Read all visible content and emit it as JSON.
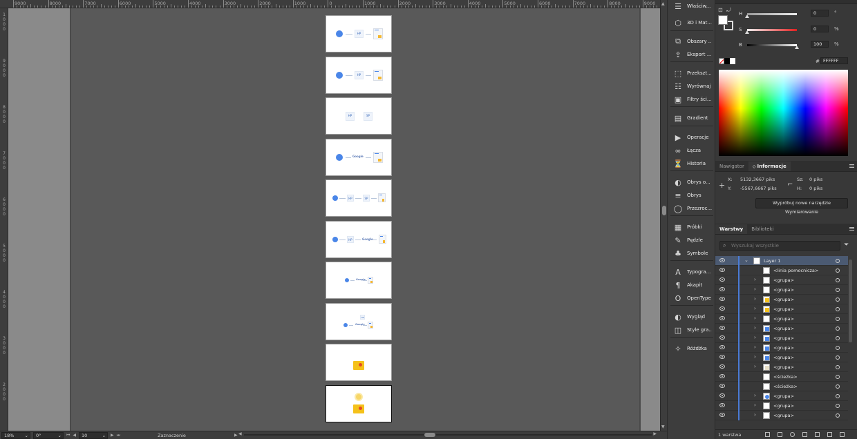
{
  "ruler": {
    "top_labels": [
      "9000",
      "8000",
      "7000",
      "6000",
      "5000",
      "4000",
      "3000",
      "2000",
      "1000",
      "0",
      "1000",
      "2000",
      "3000",
      "4000",
      "5000",
      "6000",
      "7000",
      "8000",
      "9000"
    ],
    "left_labels": [
      "1",
      "0",
      "0",
      "0",
      "9",
      "0",
      "0",
      "0",
      "8",
      "0",
      "0",
      "0",
      "7",
      "0",
      "0",
      "0",
      "6",
      "0",
      "0",
      "0",
      "5",
      "0",
      "0",
      "0",
      "4",
      "0",
      "0",
      "0",
      "3",
      "0",
      "0",
      "0",
      "2",
      "0",
      "0",
      "0",
      "1",
      "0",
      "0",
      "0"
    ]
  },
  "artboards": [
    {
      "kind": "flow-hp-doc",
      "labels": [
        "HP"
      ]
    },
    {
      "kind": "flow-hp-doc",
      "labels": [
        "HP"
      ]
    },
    {
      "kind": "two-chips",
      "labels": [
        "HP",
        "SP"
      ]
    },
    {
      "kind": "flow-google-doc",
      "labels": [
        "Google"
      ]
    },
    {
      "kind": "flow-hp-sp-doc",
      "labels": [
        "HP",
        "SP"
      ]
    },
    {
      "kind": "flow-hp-google-doc",
      "labels": [
        "HP",
        "Google"
      ]
    },
    {
      "kind": "small-google",
      "labels": [
        "Google"
      ]
    },
    {
      "kind": "small-hp-google",
      "labels": [
        "HP",
        "Google"
      ]
    },
    {
      "kind": "box",
      "labels": []
    },
    {
      "kind": "box-sun",
      "labels": []
    }
  ],
  "status": {
    "zoom": "18%",
    "rotation": "0°",
    "artboard_number": "10",
    "tool": "Zaznaczenie"
  },
  "dock": {
    "items": [
      {
        "label": "Właściw...",
        "icon": "properties-icon"
      },
      {
        "label": "3D i Mat...",
        "icon": "cube-icon"
      },
      {
        "label": "Obszary ...",
        "icon": "artboards-icon"
      },
      {
        "label": "Eksport ...",
        "icon": "export-icon"
      },
      {
        "label": "Przekszt...",
        "icon": "transform-icon"
      },
      {
        "label": "Wyrównaj",
        "icon": "align-icon"
      },
      {
        "label": "Filtry ści...",
        "icon": "pathfinder-icon"
      },
      {
        "label": "Gradient",
        "icon": "gradient-icon"
      },
      {
        "label": "Operacje",
        "icon": "actions-icon"
      },
      {
        "label": "Łącza",
        "icon": "links-icon"
      },
      {
        "label": "Historia",
        "icon": "history-icon"
      },
      {
        "label": "Obrys o...",
        "icon": "appearance-icon"
      },
      {
        "label": "Obrys",
        "icon": "stroke-icon"
      },
      {
        "label": "Przezroc...",
        "icon": "transparency-icon"
      },
      {
        "label": "Próbki",
        "icon": "swatches-icon"
      },
      {
        "label": "Pędzle",
        "icon": "brushes-icon"
      },
      {
        "label": "Symbole",
        "icon": "symbols-icon"
      },
      {
        "label": "Typogra...",
        "icon": "character-icon"
      },
      {
        "label": "Akapit",
        "icon": "paragraph-icon"
      },
      {
        "label": "OpenType",
        "icon": "opentype-icon"
      },
      {
        "label": "Wygląd",
        "icon": "appearance-icon"
      },
      {
        "label": "Style gra...",
        "icon": "graphic-styles-icon"
      },
      {
        "label": "Różdżka",
        "icon": "magic-wand-icon"
      }
    ]
  },
  "color_panel": {
    "h_label": "H",
    "h_value": "0",
    "h_unit": "°",
    "s_label": "S",
    "s_value": "0",
    "s_unit": "%",
    "b_label": "B",
    "b_value": "100",
    "b_unit": "%",
    "hex_symbol": "#",
    "hex_value": "FFFFFF"
  },
  "info_panel": {
    "tabs": [
      "Nawigator",
      "Informacje"
    ],
    "x_label": "X:",
    "x_value": "5132,3667 piks",
    "y_label": "Y:",
    "y_value": "-5567,6667 piks",
    "w_label": "Sz:",
    "w_value": "0 piks",
    "h_label": "H:",
    "h_value": "0 piks",
    "try_button": "Wypróbuj nowe narzędzie Wymiarowanie"
  },
  "layers_panel": {
    "tabs": [
      "Warstwy",
      "Biblioteki"
    ],
    "search_placeholder": "Wyszukaj wszystkie",
    "rows": [
      {
        "name": "Layer 1",
        "level": 0,
        "expand": "v",
        "thumb": "white"
      },
      {
        "name": "<linia pomocnicza>",
        "level": 1,
        "expand": "",
        "thumb": "white"
      },
      {
        "name": "<grupa>",
        "level": 1,
        "expand": ">",
        "thumb": "white"
      },
      {
        "name": "<grupa>",
        "level": 1,
        "expand": ">",
        "thumb": "white"
      },
      {
        "name": "<grupa>",
        "level": 1,
        "expand": ">",
        "thumb": "yellow"
      },
      {
        "name": "<grupa>",
        "level": 1,
        "expand": ">",
        "thumb": "yellow"
      },
      {
        "name": "<grupa>",
        "level": 1,
        "expand": ">",
        "thumb": "white"
      },
      {
        "name": "<grupa>",
        "level": 1,
        "expand": ">",
        "thumb": "blue"
      },
      {
        "name": "<grupa>",
        "level": 1,
        "expand": ">",
        "thumb": "blue"
      },
      {
        "name": "<grupa>",
        "level": 1,
        "expand": ">",
        "thumb": "blue"
      },
      {
        "name": "<grupa>",
        "level": 1,
        "expand": ">",
        "thumb": "blue"
      },
      {
        "name": "<grupa>",
        "level": 1,
        "expand": ">",
        "thumb": "grid"
      },
      {
        "name": "<ścieżka>",
        "level": 1,
        "expand": "",
        "thumb": "white"
      },
      {
        "name": "<ścieżka>",
        "level": 1,
        "expand": "",
        "thumb": "white"
      },
      {
        "name": "<grupa>",
        "level": 1,
        "expand": ">",
        "thumb": "circle"
      },
      {
        "name": "<grupa>",
        "level": 1,
        "expand": ">",
        "thumb": "white"
      },
      {
        "name": "<grupa>",
        "level": 1,
        "expand": ">",
        "thumb": "white"
      }
    ],
    "footer_count": "1 warstwa"
  }
}
